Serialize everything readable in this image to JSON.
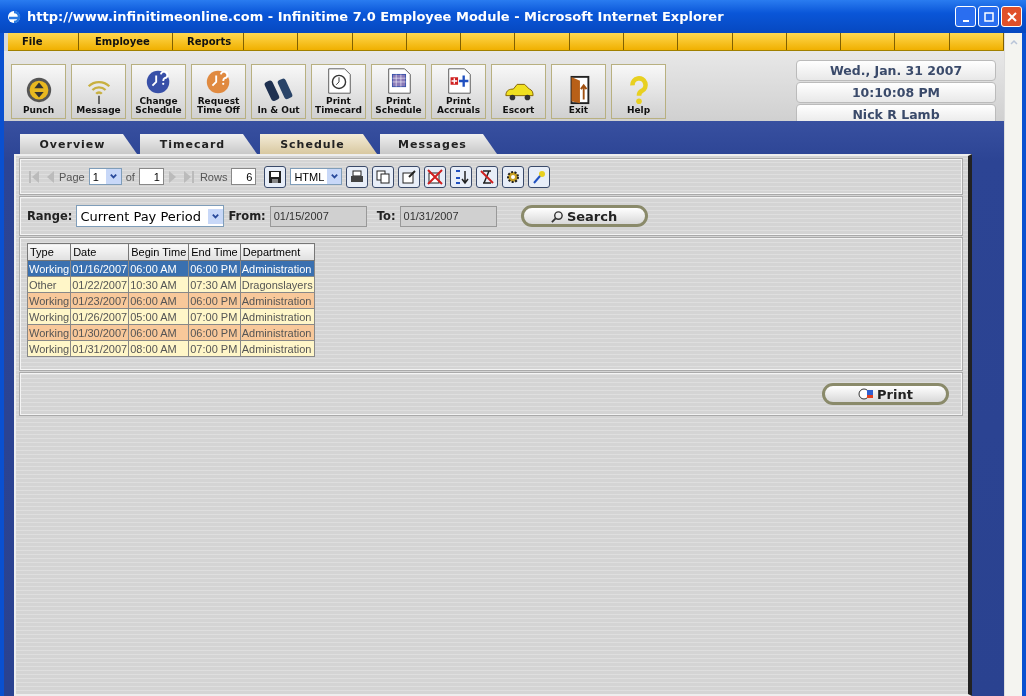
{
  "window": {
    "title": "http://www.infinitimeonline.com - Infinitime 7.0 Employee Module - Microsoft Internet Explorer"
  },
  "menu": [
    "File",
    "Employee",
    "Reports"
  ],
  "toolbar": [
    {
      "label": "Punch",
      "kind": "punch"
    },
    {
      "label": "Message",
      "kind": "message"
    },
    {
      "label": "Change Schedule",
      "kind": "change"
    },
    {
      "label": "Request Time Off",
      "kind": "request"
    },
    {
      "label": "In & Out",
      "kind": "inout"
    },
    {
      "label": "Print Timecard",
      "kind": "timecard"
    },
    {
      "label": "Print Schedule",
      "kind": "schedule"
    },
    {
      "label": "Print Accruals",
      "kind": "accruals"
    },
    {
      "label": "Escort",
      "kind": "escort"
    },
    {
      "label": "Exit",
      "kind": "exit"
    },
    {
      "label": "Help",
      "kind": "help"
    }
  ],
  "info": {
    "date": "Wed., Jan. 31 2007",
    "time": "10:10:08 PM",
    "user": "Nick R Lamb"
  },
  "tabs": [
    {
      "label": "Overview",
      "selected": false
    },
    {
      "label": "Timecard",
      "selected": false
    },
    {
      "label": "Schedule",
      "selected": true
    },
    {
      "label": "Messages",
      "selected": false
    }
  ],
  "pager": {
    "page_label": "Page",
    "page": "1",
    "of_label": "of",
    "of": "1",
    "rows_label": "Rows",
    "rows": "6",
    "format": "HTML"
  },
  "range": {
    "label": "Range:",
    "value": "Current Pay Period",
    "from_label": "From:",
    "from": "01/15/2007",
    "to_label": "To:",
    "to": "01/31/2007",
    "search": "Search"
  },
  "table": {
    "columns": [
      "Type",
      "Date",
      "Begin Time",
      "End Time",
      "Department"
    ],
    "rows": [
      {
        "cells": [
          "Working",
          "01/16/2007",
          "06:00 AM",
          "06:00 PM",
          "Administration"
        ],
        "selected": true
      },
      {
        "cells": [
          "Other",
          "01/22/2007",
          "10:30 AM",
          "07:30 AM",
          "Dragonslayers"
        ],
        "selected": false
      },
      {
        "cells": [
          "Working",
          "01/23/2007",
          "06:00 AM",
          "06:00 PM",
          "Administration"
        ],
        "selected": false
      },
      {
        "cells": [
          "Working",
          "01/26/2007",
          "05:00 AM",
          "07:00 PM",
          "Administration"
        ],
        "selected": false
      },
      {
        "cells": [
          "Working",
          "01/30/2007",
          "06:00 AM",
          "06:00 PM",
          "Administration"
        ],
        "selected": false
      },
      {
        "cells": [
          "Working",
          "01/31/2007",
          "08:00 AM",
          "07:00 PM",
          "Administration"
        ],
        "selected": false
      }
    ]
  },
  "print": "Print"
}
